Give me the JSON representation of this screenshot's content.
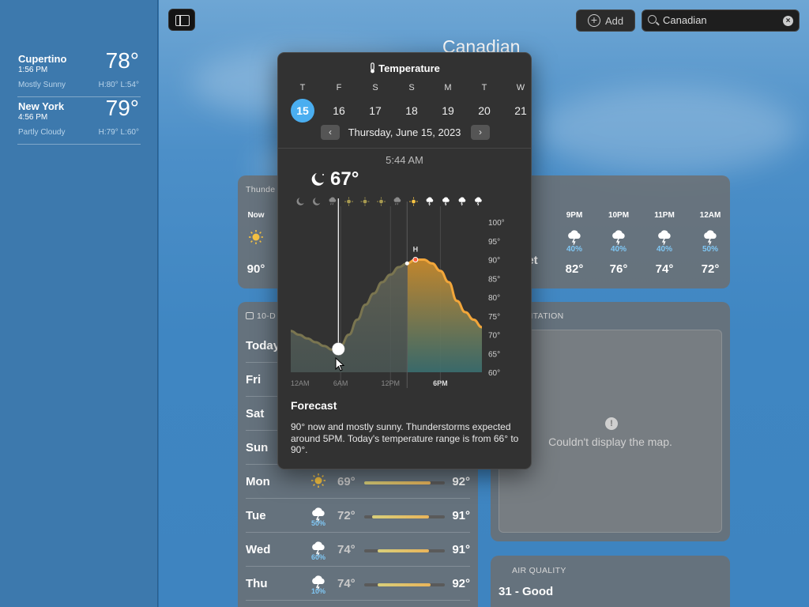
{
  "sidebar": {
    "locations": [
      {
        "name": "Cupertino",
        "time": "1:56 PM",
        "temp": "78°",
        "condition": "Mostly Sunny",
        "hilo": "H:80°  L:54°"
      },
      {
        "name": "New York",
        "time": "4:56 PM",
        "temp": "79°",
        "condition": "Partly Cloudy",
        "hilo": "H:79°  L:60°"
      }
    ]
  },
  "toolbar": {
    "add_label": "Add",
    "search_value": "Canadian",
    "search_placeholder": "Search"
  },
  "city_title": "Canadian",
  "hourly": {
    "header": "Thunde",
    "hours": [
      {
        "time": "Now",
        "icon": "sun-icon",
        "precip": "",
        "temp": "90°"
      },
      {
        "time": "",
        "icon": "",
        "precip": "",
        "temp": "et"
      },
      {
        "time": "9PM",
        "icon": "thunderstorm-icon",
        "precip": "40%",
        "temp": "82°"
      },
      {
        "time": "10PM",
        "icon": "thunderstorm-icon",
        "precip": "40%",
        "temp": "76°"
      },
      {
        "time": "11PM",
        "icon": "thunderstorm-icon",
        "precip": "40%",
        "temp": "74°"
      },
      {
        "time": "12AM",
        "icon": "thunderstorm-icon",
        "precip": "50%",
        "temp": "72°"
      }
    ]
  },
  "daily": {
    "header": "10-D",
    "days": [
      {
        "name": "Today",
        "icon": "",
        "precip": "",
        "low": "",
        "high": "",
        "low_frac": 0,
        "high_frac": 0
      },
      {
        "name": "Fri",
        "icon": "",
        "precip": "",
        "low": "",
        "high": "",
        "low_frac": 0,
        "high_frac": 0
      },
      {
        "name": "Sat",
        "icon": "",
        "precip": "",
        "low": "",
        "high": "",
        "low_frac": 0,
        "high_frac": 0
      },
      {
        "name": "Sun",
        "icon": "",
        "precip": "",
        "low": "",
        "high": "",
        "low_frac": 0,
        "high_frac": 0
      },
      {
        "name": "Mon",
        "icon": "sun-icon",
        "precip": "",
        "low": "69°",
        "high": "92°",
        "low_frac": 0.0,
        "high_frac": 0.82
      },
      {
        "name": "Tue",
        "icon": "thunderstorm-icon",
        "precip": "50%",
        "low": "72°",
        "high": "91°",
        "low_frac": 0.1,
        "high_frac": 0.8
      },
      {
        "name": "Wed",
        "icon": "thunderstorm-icon",
        "precip": "60%",
        "low": "74°",
        "high": "91°",
        "low_frac": 0.17,
        "high_frac": 0.8
      },
      {
        "name": "Thu",
        "icon": "thunderstorm-icon",
        "precip": "10%",
        "low": "74°",
        "high": "92°",
        "low_frac": 0.17,
        "high_frac": 0.82
      }
    ]
  },
  "precipitation": {
    "header": "IPITATION",
    "map_message": "Couldn't display the map."
  },
  "air_quality": {
    "header": "AIR QUALITY",
    "value": "31 - Good"
  },
  "popup": {
    "title": "Temperature",
    "weekdays": [
      "T",
      "F",
      "S",
      "S",
      "M",
      "T",
      "W"
    ],
    "dates": [
      "15",
      "16",
      "17",
      "18",
      "19",
      "20",
      "21"
    ],
    "selected_index": 0,
    "date_label": "Thursday, June 15, 2023",
    "time_readout": "5:44 AM",
    "current_temp": "67°",
    "current_icon": "moon-cloud-icon",
    "forecast_title": "Forecast",
    "forecast_text": "90° now and mostly sunny. Thunderstorms expected around 5PM. Today's temperature range is from 66° to 90°."
  },
  "chart_data": {
    "type": "area",
    "xlabels": [
      "12AM",
      "6AM",
      "12PM",
      "6PM"
    ],
    "ylabels": [
      "100°",
      "95°",
      "90°",
      "85°",
      "80°",
      "75°",
      "70°",
      "65°",
      "60°"
    ],
    "ylim": [
      60,
      100
    ],
    "hours": [
      0,
      1,
      2,
      3,
      4,
      5,
      6,
      7,
      8,
      9,
      10,
      11,
      12,
      13,
      14,
      15,
      16,
      17,
      18,
      19,
      20,
      21,
      22,
      23
    ],
    "temps": [
      71,
      70,
      69,
      68,
      67,
      66,
      67,
      70,
      74,
      78,
      81,
      84,
      86,
      88,
      89,
      90,
      90,
      89,
      87,
      84,
      79,
      76,
      74,
      72
    ],
    "selected_hour": 5.73,
    "now_hour": 14,
    "high_marker": "H",
    "hour_icons": [
      "moon-icon",
      "moon-icon",
      "rain-icon",
      "sun-icon",
      "sun-icon",
      "sun-icon",
      "rain-icon",
      "sun-icon",
      "thunderstorm-icon",
      "thunderstorm-icon",
      "thunderstorm-icon",
      "thunderstorm-icon"
    ],
    "colors": {
      "line": "#f2a63a",
      "fill_top": "#c98a2c",
      "fill_bottom": "#3a6f70"
    }
  }
}
